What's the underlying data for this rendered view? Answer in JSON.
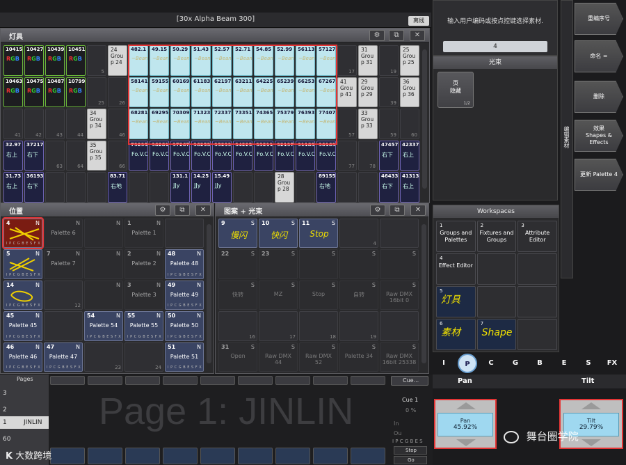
{
  "header": {
    "show_title": "[30x Alpha Beam 300]",
    "offline": "离线"
  },
  "fixtures_win": {
    "title": "灯具",
    "row1": [
      {
        "id": "10415",
        "type": "fx"
      },
      {
        "id": "10427",
        "type": "fx"
      },
      {
        "id": "10439",
        "type": "fx"
      },
      {
        "id": "10451",
        "type": "fx"
      },
      {
        "id": "",
        "num": "5",
        "type": "empty"
      },
      {
        "lines": [
          "24",
          "Grou",
          "p 24"
        ],
        "type": "grp"
      },
      {
        "id": "482.1",
        "type": "beam"
      },
      {
        "id": "49.15",
        "type": "beam"
      },
      {
        "id": "50.29",
        "type": "beam"
      },
      {
        "id": "51.43",
        "type": "beam"
      },
      {
        "id": "52.57",
        "type": "beam"
      },
      {
        "id": "52.71",
        "type": "beam"
      },
      {
        "id": "54.85",
        "type": "beam"
      },
      {
        "id": "52.99",
        "type": "beam"
      },
      {
        "id": "56113",
        "type": "beam"
      },
      {
        "id": "57127",
        "type": "beam"
      },
      {
        "id": "",
        "num": "17",
        "type": "empty"
      },
      {
        "lines": [
          "31",
          "Grou",
          "p 31"
        ],
        "type": "grp"
      },
      {
        "id": "",
        "num": "19",
        "type": "empty"
      },
      {
        "lines": [
          "25",
          "Grou",
          "p 25"
        ],
        "type": "grp"
      }
    ],
    "row2": [
      {
        "id": "10463",
        "type": "fx"
      },
      {
        "id": "10475",
        "type": "fx"
      },
      {
        "id": "10487",
        "type": "fx"
      },
      {
        "id": "10799",
        "type": "fx"
      },
      {
        "id": "",
        "num": "25",
        "type": "empty"
      },
      {
        "id": "",
        "num": "26",
        "type": "empty"
      },
      {
        "id": "58141",
        "type": "beam"
      },
      {
        "id": "59155",
        "type": "beam"
      },
      {
        "id": "60169",
        "type": "beam"
      },
      {
        "id": "61183",
        "type": "beam"
      },
      {
        "id": "62197",
        "type": "beam"
      },
      {
        "id": "63211",
        "type": "beam"
      },
      {
        "id": "64225",
        "type": "beam"
      },
      {
        "id": "65239",
        "type": "beam"
      },
      {
        "id": "66253",
        "type": "beam"
      },
      {
        "id": "67267",
        "type": "beam"
      },
      {
        "lines": [
          "41",
          "Grou",
          "p 41"
        ],
        "type": "grp"
      },
      {
        "lines": [
          "29",
          "Grou",
          "p 29"
        ],
        "type": "grp"
      },
      {
        "id": "",
        "num": "39",
        "type": "empty"
      },
      {
        "lines": [
          "36",
          "Grou",
          "p 36"
        ],
        "type": "grp"
      }
    ],
    "row3": [
      {
        "id": "",
        "num": "41",
        "type": "empty"
      },
      {
        "id": "",
        "num": "42",
        "type": "empty"
      },
      {
        "id": "",
        "num": "43",
        "type": "empty"
      },
      {
        "id": "",
        "num": "44",
        "type": "empty"
      },
      {
        "lines": [
          "34",
          "Grou",
          "p 34"
        ],
        "type": "grp"
      },
      {
        "id": "",
        "num": "46",
        "type": "empty"
      },
      {
        "id": "68281",
        "type": "beam"
      },
      {
        "id": "69295",
        "type": "beam"
      },
      {
        "id": "70309",
        "type": "beam"
      },
      {
        "id": "71323",
        "type": "beam"
      },
      {
        "id": "72337",
        "type": "beam"
      },
      {
        "id": "73351",
        "type": "beam"
      },
      {
        "id": "74365",
        "type": "beam"
      },
      {
        "id": "75379",
        "type": "beam"
      },
      {
        "id": "76393",
        "type": "beam"
      },
      {
        "id": "77407",
        "type": "beam"
      },
      {
        "id": "",
        "num": "57",
        "type": "empty"
      },
      {
        "lines": [
          "33",
          "Grou",
          "p 33"
        ],
        "type": "grp"
      },
      {
        "id": "",
        "num": "59",
        "type": "empty"
      },
      {
        "id": "",
        "num": "60",
        "type": "empty"
      }
    ],
    "row4": [
      {
        "id": "32.97",
        "t": "右上",
        "type": "pos"
      },
      {
        "id": "37217",
        "t": "右下",
        "type": "pos"
      },
      {
        "id": "",
        "num": "63",
        "type": "empty"
      },
      {
        "id": "",
        "num": "64",
        "type": "empty"
      },
      {
        "lines": [
          "35",
          "Grou",
          "p 35"
        ],
        "type": "grp"
      },
      {
        "id": "",
        "num": "66",
        "type": "empty"
      },
      {
        "id": "79295",
        "t": "Fo.V.C",
        "type": "pos"
      },
      {
        "id": "98281",
        "t": "Fo.V.C",
        "type": "pos"
      },
      {
        "id": "97267",
        "t": "Fo.V.C",
        "type": "pos"
      },
      {
        "id": "96253",
        "t": "Fo.V.C",
        "type": "pos"
      },
      {
        "id": "95239",
        "t": "Fo.V.C",
        "type": "pos"
      },
      {
        "id": "94225",
        "t": "Fo.V.C",
        "type": "pos"
      },
      {
        "id": "93211",
        "t": "Fo.V.C",
        "type": "pos"
      },
      {
        "id": "92197",
        "t": "Fo.V.C",
        "type": "pos"
      },
      {
        "id": "91183",
        "t": "Fo.V.C",
        "type": "pos"
      },
      {
        "id": "90169",
        "t": "Fo.V.C",
        "type": "pos"
      },
      {
        "id": "",
        "num": "77",
        "type": "empty"
      },
      {
        "id": "",
        "num": "78",
        "type": "empty"
      },
      {
        "id": "47457",
        "t": "右下",
        "type": "pos"
      },
      {
        "id": "42337",
        "t": "右上",
        "type": "pos"
      }
    ],
    "row5": [
      {
        "id": "31.73",
        "t": "右上",
        "type": "pos"
      },
      {
        "id": "36193",
        "t": "右下",
        "type": "pos"
      },
      {
        "id": "",
        "num": "",
        "type": "empty"
      },
      {
        "id": "",
        "num": "",
        "type": "empty"
      },
      {
        "id": "",
        "num": "",
        "type": "empty"
      },
      {
        "id": "83.71",
        "t": "右地",
        "type": "pos"
      },
      {
        "id": "",
        "num": "",
        "type": "empty"
      },
      {
        "id": "",
        "num": "",
        "type": "empty"
      },
      {
        "id": "131.1",
        "t": "JJy",
        "type": "pos"
      },
      {
        "id": "14.25",
        "t": "JJy",
        "type": "pos"
      },
      {
        "id": "15.49",
        "t": "JJy",
        "type": "pos"
      },
      {
        "id": "",
        "num": "",
        "type": "empty"
      },
      {
        "id": "",
        "num": "",
        "type": "empty"
      },
      {
        "lines": [
          "28",
          "Grou",
          "p 28"
        ],
        "type": "grp"
      },
      {
        "id": "",
        "num": "",
        "type": "empty"
      },
      {
        "id": "89155",
        "t": "右地",
        "type": "pos"
      },
      {
        "id": "",
        "num": "",
        "type": "empty"
      },
      {
        "id": "",
        "num": "",
        "type": "empty"
      },
      {
        "id": "46433",
        "t": "右下",
        "type": "pos"
      },
      {
        "id": "41313",
        "t": "右上",
        "type": "pos"
      }
    ]
  },
  "position_win": {
    "title": "位置",
    "cells": [
      {
        "id": "4",
        "n": "N",
        "label": "",
        "footer": "I P C G B E S F X",
        "style": "sel"
      },
      {
        "id": "",
        "n": "N",
        "label": "Palette 6",
        "footer": "",
        "style": "dim"
      },
      {
        "id": "",
        "n": "N",
        "label": "",
        "footer": "",
        "style": "dim"
      },
      {
        "id": "1",
        "n": "N",
        "label": "Palette 1",
        "footer": "",
        "style": "dim"
      },
      {
        "id": "",
        "n": "",
        "label": "",
        "footer": "",
        "style": "empty"
      },
      {
        "id": "5",
        "n": "N",
        "label": "",
        "footer": "I P C G B E S F X",
        "style": "on"
      },
      {
        "id": "7",
        "n": "N",
        "label": "Palette 7",
        "footer": "",
        "style": "dim"
      },
      {
        "id": "",
        "n": "N",
        "label": "",
        "footer": "",
        "style": "dim"
      },
      {
        "id": "2",
        "n": "N",
        "label": "Palette 2",
        "footer": "",
        "style": "dim"
      },
      {
        "id": "48",
        "n": "N",
        "label": "Palette 48",
        "footer": "I P C G B E S F X",
        "style": "on"
      },
      {
        "id": "14",
        "n": "N",
        "label": "",
        "footer": "I P C G B E S F X",
        "style": "on"
      },
      {
        "id": "",
        "n": "",
        "label": "",
        "footer": "12",
        "style": "empty"
      },
      {
        "id": "",
        "n": "N",
        "label": "",
        "footer": "",
        "style": "dim"
      },
      {
        "id": "3",
        "n": "N",
        "label": "Palette 3",
        "footer": "",
        "style": "dim"
      },
      {
        "id": "49",
        "n": "N",
        "label": "Palette 49",
        "footer": "I P C G B E S F X",
        "style": "on"
      },
      {
        "id": "45",
        "n": "N",
        "label": "Palette 45",
        "footer": "I P C G B E S F X",
        "style": "on"
      },
      {
        "id": "",
        "n": "",
        "label": "",
        "footer": "",
        "style": "empty"
      },
      {
        "id": "54",
        "n": "N",
        "label": "Palette 54",
        "footer": "I P C G B E S F X",
        "style": "on"
      },
      {
        "id": "55",
        "n": "N",
        "label": "Palette 55",
        "footer": "I P C G B E S F X",
        "style": "on"
      },
      {
        "id": "50",
        "n": "N",
        "label": "Palette 50",
        "footer": "I P C G B E S F X",
        "style": "on"
      },
      {
        "id": "46",
        "n": "N",
        "label": "Palette 46",
        "footer": "I P C G B E S F X",
        "style": "on"
      },
      {
        "id": "47",
        "n": "N",
        "label": "Palette 47",
        "footer": "I P C G B E S F X",
        "style": "on"
      },
      {
        "id": "",
        "n": "",
        "label": "",
        "footer": "23",
        "style": "empty"
      },
      {
        "id": "",
        "n": "",
        "label": "",
        "footer": "24",
        "style": "empty"
      },
      {
        "id": "51",
        "n": "N",
        "label": "Palette 51",
        "footer": "I P C G B E S F X",
        "style": "on"
      }
    ]
  },
  "gobo_win": {
    "title": "图案 + 光束",
    "cells": [
      {
        "id": "9",
        "s": "S",
        "label": "慢闪",
        "style": "on"
      },
      {
        "id": "10",
        "s": "S",
        "label": "快闪",
        "style": "on"
      },
      {
        "id": "11",
        "s": "S",
        "label": "Stop",
        "style": "on"
      },
      {
        "id": "",
        "s": "",
        "label": "4",
        "style": "empty"
      },
      {
        "id": "",
        "s": "",
        "label": "",
        "style": "empty"
      },
      {
        "id": "22",
        "s": "S",
        "label": "",
        "style": "dim"
      },
      {
        "id": "23",
        "s": "S",
        "label": "",
        "style": "dim"
      },
      {
        "id": "",
        "s": "S",
        "label": "",
        "style": "dim"
      },
      {
        "id": "",
        "s": "S",
        "label": "",
        "style": "dim"
      },
      {
        "id": "",
        "s": "S",
        "label": "",
        "style": "dim"
      },
      {
        "id": "",
        "s": "S",
        "label": "快转",
        "style": "dim"
      },
      {
        "id": "",
        "s": "S",
        "label": "MZ",
        "style": "dim"
      },
      {
        "id": "",
        "s": "S",
        "label": "Stop",
        "style": "dim"
      },
      {
        "id": "",
        "s": "S",
        "label": "自转",
        "style": "dim"
      },
      {
        "id": "",
        "s": "S",
        "label": "Raw DMX 16bit 0",
        "style": "dim"
      },
      {
        "id": "",
        "s": "",
        "label": "16",
        "style": "empty"
      },
      {
        "id": "",
        "s": "",
        "label": "17",
        "style": "empty"
      },
      {
        "id": "",
        "s": "",
        "label": "18",
        "style": "empty"
      },
      {
        "id": "",
        "s": "",
        "label": "19",
        "style": "empty"
      },
      {
        "id": "",
        "s": "",
        "label": "",
        "style": "empty"
      },
      {
        "id": "31",
        "s": "S",
        "label": "Open",
        "style": "dim"
      },
      {
        "id": "",
        "s": "S",
        "label": "Raw DMX 44",
        "style": "dim"
      },
      {
        "id": "",
        "s": "S",
        "label": "Raw DMX 52",
        "style": "dim"
      },
      {
        "id": "",
        "s": "S",
        "label": "Palette 34",
        "style": "dim"
      },
      {
        "id": "",
        "s": "S",
        "label": "Raw DMX 16bit 25338",
        "style": "dim"
      }
    ]
  },
  "right_top": {
    "prompt": "输入用户编码或按点控键选择素材.",
    "value": "4",
    "beam_header": "光束",
    "page_btn": "页\n隐藏",
    "page_count": "1/2",
    "side_label": "编辑素材"
  },
  "right_buttons": [
    "重编序号",
    "命名 =",
    "删除",
    "效果\nShapes &\nEffects",
    "更新 Palette 4"
  ],
  "workspaces": {
    "title": "Workspaces",
    "items": [
      {
        "id": "1",
        "label": "Groups and\nPalettes"
      },
      {
        "id": "2",
        "label": "Fixtures and\nGroups"
      },
      {
        "id": "3",
        "label": "Attribute\nEditor"
      },
      {
        "id": "4",
        "label": "Effect Editor"
      },
      {
        "id": "",
        "label": ""
      },
      {
        "id": "",
        "label": ""
      },
      {
        "id": "5",
        "label": "灯具"
      },
      {
        "id": "",
        "label": ""
      },
      {
        "id": "",
        "label": ""
      },
      {
        "id": "6",
        "label": "素材"
      },
      {
        "id": "7",
        "label": "Shape"
      },
      {
        "id": "",
        "label": ""
      }
    ]
  },
  "attr_tabs": [
    "I",
    "P",
    "C",
    "G",
    "B",
    "E",
    "S",
    "FX"
  ],
  "encoders": {
    "pan_header": "Pan",
    "tilt_header": "Tilt",
    "pan_label": "Pan",
    "pan_value": "45.92%",
    "tilt_label": "Tilt",
    "tilt_value": "29.79%"
  },
  "bottom": {
    "pages_label": "Pages",
    "page_list": [
      "3",
      "2",
      "1",
      "60"
    ],
    "page_name": "JINLIN",
    "big_page": "Page 1: JINLIN",
    "cue_btn": "Cue...",
    "cue_label": "Cue 1",
    "cue_pct": "0 %",
    "in_label": "In",
    "out_label": "Ou",
    "ipcgbes": "I P C G B E S",
    "stop": "Stop",
    "go": "Go"
  },
  "watermarks": {
    "left": "大数跨境",
    "right": "舞台圈学院"
  }
}
